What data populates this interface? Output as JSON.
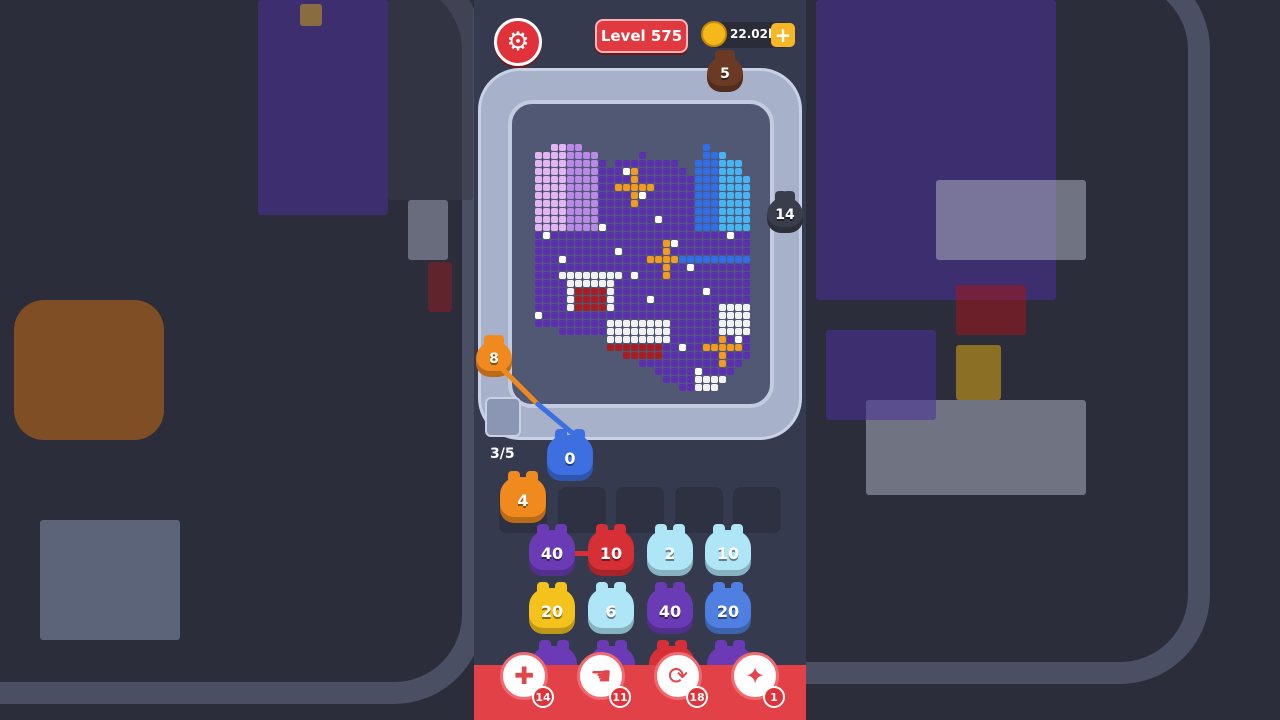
{
  "hud": {
    "settings_icon": "gear-icon",
    "level_text": "Level 575",
    "coin_amount": "22.02k",
    "coin_add_label": "+"
  },
  "track_pigs": {
    "top_pig": "5",
    "right_pig": "14",
    "left_pig": "8",
    "launch_pig": "0"
  },
  "queue": {
    "capacity_text": "3/5",
    "slot_pigs": [
      "4"
    ]
  },
  "pig_grid": {
    "rows": [
      [
        "40",
        "10",
        "2",
        "10"
      ],
      [
        "20",
        "6",
        "40",
        "20"
      ]
    ],
    "colors": [
      [
        "#6a3bb5",
        "#d72f36",
        "#aee5f7",
        "#aee5f7"
      ],
      [
        "#f4c21d",
        "#aee5f7",
        "#6a3bb5",
        "#4f7fe0"
      ]
    ]
  },
  "tools": [
    {
      "name": "add-slot-tool",
      "icon": "add-card-icon",
      "glyph": "✚",
      "count": "14"
    },
    {
      "name": "hand-tool",
      "icon": "hand-icon",
      "glyph": "☚",
      "count": "11"
    },
    {
      "name": "shuffle-tool",
      "icon": "shuffle-icon",
      "glyph": "⟳",
      "count": "18"
    },
    {
      "name": "magic-tool",
      "icon": "magic-pig-icon",
      "glyph": "✦",
      "count": "1"
    }
  ],
  "colors": {
    "purple": "#5a2fb0",
    "red": "#d72f36",
    "orange": "#f08a1e",
    "blue": "#3d6fe0",
    "yellow": "#f4c21d"
  }
}
